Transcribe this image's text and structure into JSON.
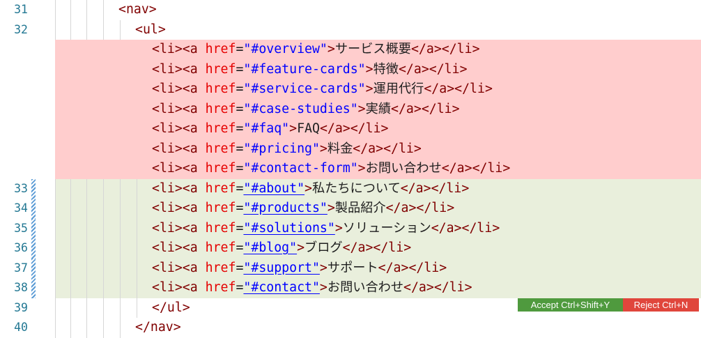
{
  "editor": {
    "lines": [
      {
        "num": "31",
        "kind": "normal",
        "parts": [
          {
            "t": "<nav>",
            "c": "tag"
          }
        ]
      },
      {
        "num": "32",
        "kind": "normal",
        "parts": [
          {
            "t": "<ul>",
            "c": "tag"
          }
        ]
      },
      {
        "num": "",
        "kind": "removed",
        "parts": [
          {
            "t": "<li><a ",
            "c": "tag"
          },
          {
            "t": "href",
            "c": "attr"
          },
          {
            "t": "=",
            "c": "txt"
          },
          {
            "t": "\"#overview\"",
            "c": "str"
          },
          {
            "t": ">",
            "c": "tag"
          },
          {
            "t": "サービス概要",
            "c": "txt"
          },
          {
            "t": "</a></li>",
            "c": "tag"
          }
        ]
      },
      {
        "num": "",
        "kind": "removed",
        "parts": [
          {
            "t": "<li><a ",
            "c": "tag"
          },
          {
            "t": "href",
            "c": "attr"
          },
          {
            "t": "=",
            "c": "txt"
          },
          {
            "t": "\"#feature-cards\"",
            "c": "str"
          },
          {
            "t": ">",
            "c": "tag"
          },
          {
            "t": "特徴",
            "c": "txt"
          },
          {
            "t": "</a></li>",
            "c": "tag"
          }
        ]
      },
      {
        "num": "",
        "kind": "removed",
        "parts": [
          {
            "t": "<li><a ",
            "c": "tag"
          },
          {
            "t": "href",
            "c": "attr"
          },
          {
            "t": "=",
            "c": "txt"
          },
          {
            "t": "\"#service-cards\"",
            "c": "str"
          },
          {
            "t": ">",
            "c": "tag"
          },
          {
            "t": "運用代行",
            "c": "txt"
          },
          {
            "t": "</a></li>",
            "c": "tag"
          }
        ]
      },
      {
        "num": "",
        "kind": "removed",
        "parts": [
          {
            "t": "<li><a ",
            "c": "tag"
          },
          {
            "t": "href",
            "c": "attr"
          },
          {
            "t": "=",
            "c": "txt"
          },
          {
            "t": "\"#case-studies\"",
            "c": "str"
          },
          {
            "t": ">",
            "c": "tag"
          },
          {
            "t": "実績",
            "c": "txt"
          },
          {
            "t": "</a></li>",
            "c": "tag"
          }
        ]
      },
      {
        "num": "",
        "kind": "removed",
        "parts": [
          {
            "t": "<li><a ",
            "c": "tag"
          },
          {
            "t": "href",
            "c": "attr"
          },
          {
            "t": "=",
            "c": "txt"
          },
          {
            "t": "\"#faq\"",
            "c": "str"
          },
          {
            "t": ">",
            "c": "tag"
          },
          {
            "t": "FAQ",
            "c": "txt"
          },
          {
            "t": "</a></li>",
            "c": "tag"
          }
        ]
      },
      {
        "num": "",
        "kind": "removed",
        "parts": [
          {
            "t": "<li><a ",
            "c": "tag"
          },
          {
            "t": "href",
            "c": "attr"
          },
          {
            "t": "=",
            "c": "txt"
          },
          {
            "t": "\"#pricing\"",
            "c": "str"
          },
          {
            "t": ">",
            "c": "tag"
          },
          {
            "t": "料金",
            "c": "txt"
          },
          {
            "t": "</a></li>",
            "c": "tag"
          }
        ]
      },
      {
        "num": "",
        "kind": "removed",
        "parts": [
          {
            "t": "<li><a ",
            "c": "tag"
          },
          {
            "t": "href",
            "c": "attr"
          },
          {
            "t": "=",
            "c": "txt"
          },
          {
            "t": "\"#contact-form\"",
            "c": "str"
          },
          {
            "t": ">",
            "c": "tag"
          },
          {
            "t": "お問い合わせ",
            "c": "txt"
          },
          {
            "t": "</a></li>",
            "c": "tag"
          }
        ]
      },
      {
        "num": "33",
        "kind": "added",
        "parts": [
          {
            "t": "<li><a ",
            "c": "tag"
          },
          {
            "t": "href",
            "c": "attr"
          },
          {
            "t": "=",
            "c": "txt"
          },
          {
            "t": "\"#about\"",
            "c": "str link"
          },
          {
            "t": ">",
            "c": "tag"
          },
          {
            "t": "私たちについて",
            "c": "txt"
          },
          {
            "t": "</a></li>",
            "c": "tag"
          }
        ]
      },
      {
        "num": "34",
        "kind": "added",
        "parts": [
          {
            "t": "<li><a ",
            "c": "tag"
          },
          {
            "t": "href",
            "c": "attr"
          },
          {
            "t": "=",
            "c": "txt"
          },
          {
            "t": "\"#products\"",
            "c": "str link"
          },
          {
            "t": ">",
            "c": "tag"
          },
          {
            "t": "製品紹介",
            "c": "txt"
          },
          {
            "t": "</a></li>",
            "c": "tag"
          }
        ]
      },
      {
        "num": "35",
        "kind": "added",
        "parts": [
          {
            "t": "<li><a ",
            "c": "tag"
          },
          {
            "t": "href",
            "c": "attr"
          },
          {
            "t": "=",
            "c": "txt"
          },
          {
            "t": "\"#solutions\"",
            "c": "str link"
          },
          {
            "t": ">",
            "c": "tag"
          },
          {
            "t": "ソリューション",
            "c": "txt"
          },
          {
            "t": "</a></li>",
            "c": "tag"
          }
        ]
      },
      {
        "num": "36",
        "kind": "added",
        "parts": [
          {
            "t": "<li><a ",
            "c": "tag"
          },
          {
            "t": "href",
            "c": "attr"
          },
          {
            "t": "=",
            "c": "txt"
          },
          {
            "t": "\"#blog\"",
            "c": "str link"
          },
          {
            "t": ">",
            "c": "tag"
          },
          {
            "t": "ブログ",
            "c": "txt"
          },
          {
            "t": "</a></li>",
            "c": "tag"
          }
        ]
      },
      {
        "num": "37",
        "kind": "added",
        "parts": [
          {
            "t": "<li><a ",
            "c": "tag"
          },
          {
            "t": "href",
            "c": "attr"
          },
          {
            "t": "=",
            "c": "txt"
          },
          {
            "t": "\"#support\"",
            "c": "str link"
          },
          {
            "t": ">",
            "c": "tag"
          },
          {
            "t": "サポート",
            "c": "txt"
          },
          {
            "t": "</a></li>",
            "c": "tag"
          }
        ]
      },
      {
        "num": "38",
        "kind": "added",
        "parts": [
          {
            "t": "<li><a ",
            "c": "tag"
          },
          {
            "t": "href",
            "c": "attr"
          },
          {
            "t": "=",
            "c": "txt"
          },
          {
            "t": "\"#contact\"",
            "c": "str link"
          },
          {
            "t": ">",
            "c": "tag"
          },
          {
            "t": "お問い合わせ",
            "c": "txt"
          },
          {
            "t": "</a></li>",
            "c": "tag"
          }
        ]
      },
      {
        "num": "39",
        "kind": "normal",
        "parts": [
          {
            "t": "</ul>",
            "c": "tag"
          }
        ]
      },
      {
        "num": "40",
        "kind": "normal",
        "parts": [
          {
            "t": "</nav>",
            "c": "tag"
          }
        ]
      }
    ]
  },
  "diff_actions": {
    "accept_label": "Accept Ctrl+Shift+Y",
    "reject_label": "Reject Ctrl+N"
  },
  "colors": {
    "removed_bg": "#ffcdcd",
    "added_bg": "#e9efdc",
    "accept": "#4f9a3e",
    "reject": "#e0463c"
  }
}
